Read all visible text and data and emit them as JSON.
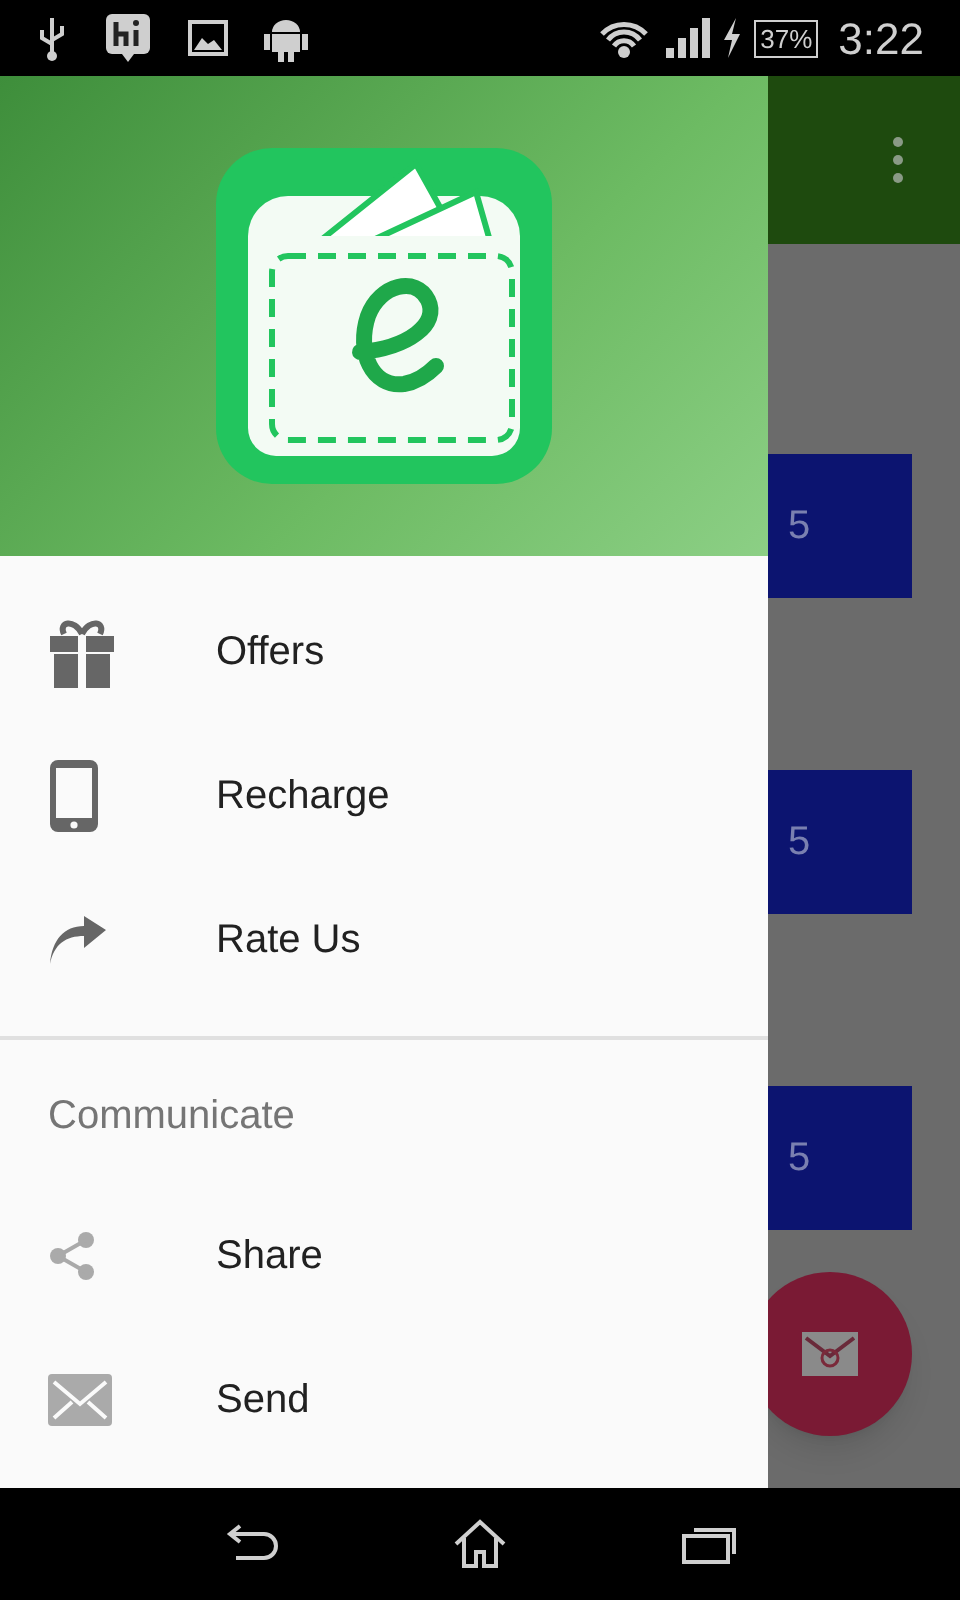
{
  "status_bar": {
    "battery": "37%",
    "time": "3:22"
  },
  "background": {
    "cards": [
      {
        "text": "5"
      },
      {
        "text": "5"
      },
      {
        "text": "5"
      }
    ]
  },
  "drawer": {
    "sections": [
      {
        "items": [
          {
            "label": "Offers"
          },
          {
            "label": "Recharge"
          },
          {
            "label": "Rate Us"
          }
        ]
      },
      {
        "title": "Communicate",
        "items": [
          {
            "label": "Share"
          },
          {
            "label": "Send"
          }
        ]
      }
    ]
  }
}
